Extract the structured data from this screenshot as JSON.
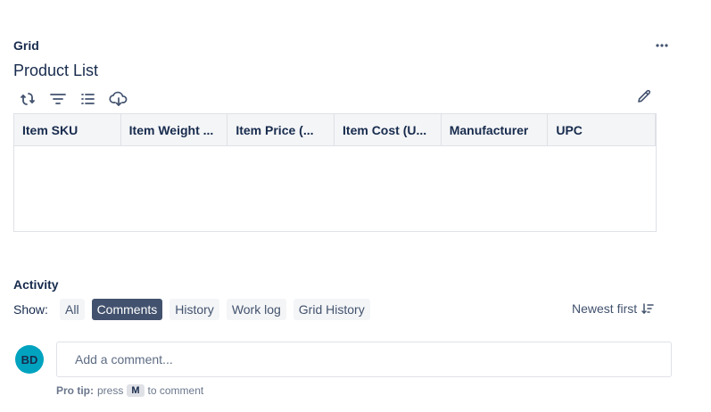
{
  "grid": {
    "section_label": "Grid",
    "title": "Product List",
    "columns": [
      "Item SKU",
      "Item Weight ...",
      "Item Price (...",
      "Item Cost (U...",
      "Manufacturer",
      "UPC"
    ],
    "toolbar_icons": [
      "refresh-icon",
      "filter-icon",
      "list-icon",
      "cloud-download-icon"
    ]
  },
  "activity": {
    "section_label": "Activity",
    "show_label": "Show:",
    "filters": [
      "All",
      "Comments",
      "History",
      "Work log",
      "Grid History"
    ],
    "active_filter": "Comments",
    "sort_label": "Newest first"
  },
  "comment": {
    "avatar_initials": "BD",
    "placeholder": "Add a comment...",
    "pro_tip_label": "Pro tip:",
    "pro_tip_press": "press",
    "pro_tip_key": "M",
    "pro_tip_suffix": "to comment"
  },
  "colors": {
    "accent": "#42526e",
    "avatar": "#00a3bf",
    "text": "#172b4d"
  }
}
